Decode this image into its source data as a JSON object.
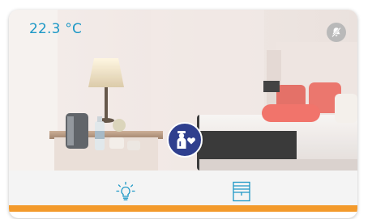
{
  "room": {
    "temperature": "22.3 °C",
    "status_icon": "notifications-off-icon",
    "scene_icon": "do-not-disturb-person-heart-icon"
  },
  "controls": [
    {
      "icon": "lightbulb-icon"
    },
    {
      "icon": "window-blind-icon"
    }
  ],
  "colors": {
    "temperature": "#1d98c6",
    "icons": "#1d98c6",
    "badge": "#2f3f8e",
    "status_icon_bg": "#b9b9b9",
    "accent_bar": "#f39a2b",
    "footer_bg": "#f4f4f4"
  }
}
